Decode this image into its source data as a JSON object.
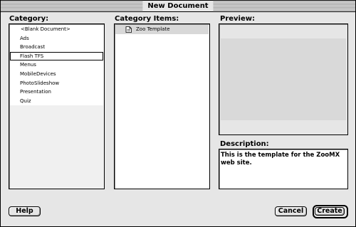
{
  "window": {
    "title": "New Document"
  },
  "category": {
    "label": "Category:",
    "items": [
      {
        "label": "<Blank Document>"
      },
      {
        "label": "Ads"
      },
      {
        "label": "Broadcast"
      },
      {
        "label": "Flash TFS",
        "selected": true
      },
      {
        "label": "Menus"
      },
      {
        "label": "MobileDevices"
      },
      {
        "label": "PhotoSlideshow"
      },
      {
        "label": "Presentation"
      },
      {
        "label": "Quiz"
      }
    ]
  },
  "category_items": {
    "label": "Category Items:",
    "items": [
      {
        "label": "Zoo Template",
        "icon": "document-icon",
        "selected": true
      }
    ]
  },
  "preview": {
    "label": "Preview:"
  },
  "description": {
    "label": "Description:",
    "text": "This is the template for the ZooMX web site."
  },
  "buttons": {
    "help": "Help",
    "cancel": "Cancel",
    "create": "Create"
  }
}
